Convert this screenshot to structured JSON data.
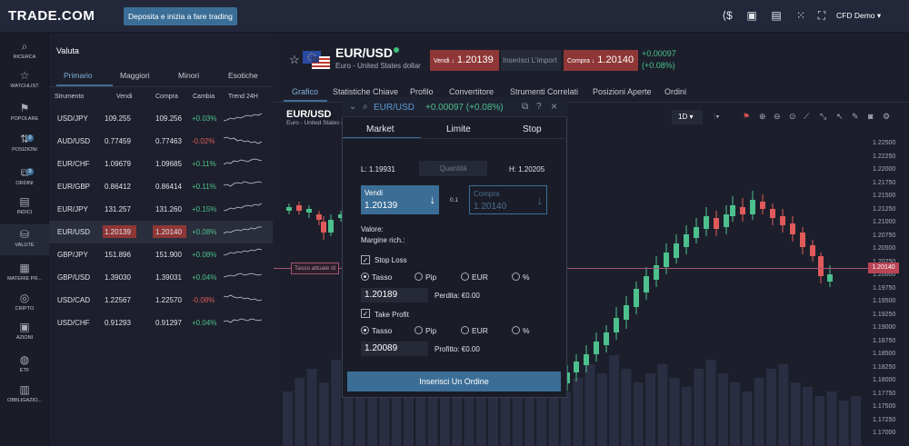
{
  "header": {
    "logo": "TRADE.COM",
    "deposit": "Deposita e inizia a fare trading",
    "account": "CFD Demo ▾"
  },
  "nav": [
    {
      "label": "RICERCA",
      "icon": "search-icon",
      "glyph": "⌕"
    },
    {
      "label": "WATCHLIST",
      "icon": "star-icon",
      "glyph": "☆"
    },
    {
      "label": "POPOLARE",
      "icon": "flag-icon",
      "glyph": "⚑"
    },
    {
      "label": "POSIZIONI",
      "icon": "positions-icon",
      "glyph": "⇅",
      "badge": "0"
    },
    {
      "label": "ORDINI",
      "icon": "orders-icon",
      "glyph": "⧉",
      "badge": "0"
    },
    {
      "label": "INDICI",
      "icon": "indices-icon",
      "glyph": "▤"
    },
    {
      "label": "VALUTE",
      "icon": "currency-icon",
      "glyph": "⛁"
    },
    {
      "label": "MATERIE PR...",
      "icon": "commodities-icon",
      "glyph": "▦"
    },
    {
      "label": "CRIPTO",
      "icon": "crypto-icon",
      "glyph": "◎"
    },
    {
      "label": "AZIONI",
      "icon": "stocks-icon",
      "glyph": "▣"
    },
    {
      "label": "ETF",
      "icon": "etf-icon",
      "glyph": "◍"
    },
    {
      "label": "OBBLIGAZIO...",
      "icon": "bonds-icon",
      "glyph": "▥"
    }
  ],
  "watch": {
    "title": "Valuta",
    "tabs": [
      "Primario",
      "Maggiori",
      "Minori",
      "Esotiche"
    ],
    "cols": [
      "Strumento",
      "Vendi",
      "Compra",
      "Cambia",
      "Trend 24H"
    ],
    "rows": [
      [
        "USD/JPY",
        "109.255",
        "109.256",
        "+0.03%"
      ],
      [
        "AUD/USD",
        "0.77459",
        "0.77463",
        "-0.02%"
      ],
      [
        "EUR/CHF",
        "1.09679",
        "1.09685",
        "+0.11%"
      ],
      [
        "EUR/GBP",
        "0.86412",
        "0.86414",
        "+0.11%"
      ],
      [
        "EUR/JPY",
        "131.257",
        "131.260",
        "+0.15%"
      ],
      [
        "EUR/USD",
        "1.20139",
        "1.20140",
        "+0.08%"
      ],
      [
        "GBP/JPY",
        "151.896",
        "151.900",
        "+0.08%"
      ],
      [
        "GBP/USD",
        "1.39030",
        "1.39031",
        "+0.04%"
      ],
      [
        "USD/CAD",
        "1.22567",
        "1.22570",
        "-0.08%"
      ],
      [
        "USD/CHF",
        "0.91293",
        "0.91297",
        "+0.04%"
      ]
    ]
  },
  "instrument": {
    "symbol": "EUR/USD",
    "subtitle": "Euro - United States dollar",
    "sell_label": "Vendi ↓",
    "sell": "1.20139",
    "amount_placeholder": "Inserisci L'import",
    "buy_label": "Compra ↓",
    "buy": "1.20140",
    "change": "+0.00097",
    "change_pct": "(+0.08%)"
  },
  "main_tabs": [
    "Grafico",
    "Statistiche Chiave",
    "Profilo",
    "Convertitore",
    "Strumenti Correlati",
    "Posizioni Aperte",
    "Ordini"
  ],
  "chart": {
    "title": "EUR/USD",
    "subtitle": "Euro - United States d",
    "timeframe": "1D",
    "current_price": "1.20140",
    "current_label": "Tasso attuale di",
    "yticks": [
      "1.22500",
      "1.22250",
      "1.22000",
      "1.21750",
      "1.21500",
      "1.21250",
      "1.21000",
      "1.20750",
      "1.20500",
      "1.20250",
      "1.20000",
      "1.19750",
      "1.19500",
      "1.19250",
      "1.19000",
      "1.18750",
      "1.18500",
      "1.18250",
      "1.18000",
      "1.17750",
      "1.17500",
      "1.17250",
      "1.17000"
    ]
  },
  "order": {
    "symbol": "EUR/USD",
    "change": "+0.00097 (+0.08%)",
    "tabs": [
      "Market",
      "Limite",
      "Stop"
    ],
    "low": "L: 1.19931",
    "qty_placeholder": "Quantità",
    "high": "H: 1.20205",
    "sell_label": "Vendi",
    "sell": "1.20139",
    "step": "0.1",
    "buy_label": "Compra",
    "buy": "1.20140",
    "valore": "Valore:",
    "margine": "Margine rich.:",
    "stop_loss": {
      "label": "Stop Loss",
      "options": [
        "Tasso",
        "Pip",
        "EUR",
        "%"
      ],
      "value": "1.20189",
      "result": "Perdita: €0.00"
    },
    "take_profit": {
      "label": "Take Profit",
      "options": [
        "Tasso",
        "Pip",
        "EUR",
        "%"
      ],
      "value": "1.20089",
      "result": "Profitto: €0.00"
    },
    "submit": "Inserisci Un Ordine"
  },
  "colors": {
    "up": "#4cc08d",
    "down": "#e05a5a",
    "accent": "#3b6e96"
  }
}
